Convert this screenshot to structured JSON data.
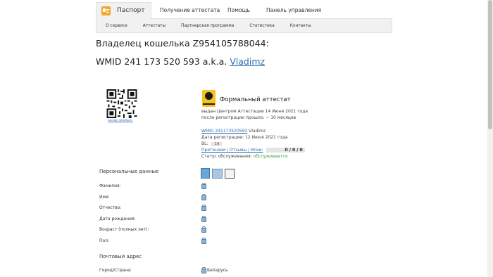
{
  "topnav": {
    "active": "Паспорт",
    "items": [
      "Получение аттестата",
      "Помощь",
      "Панель управления"
    ]
  },
  "subnav": [
    "О сервисе",
    "Аттестаты",
    "Партнерская программа",
    "Статистика",
    "Контакты"
  ],
  "owner": {
    "title": "Владелец кошелька Z954105788044:",
    "wmid_prefix": "WMID 241 173 520 593 a.k.a.",
    "nick": "Vladimz"
  },
  "qr": {
    "caption": "паспорт WebMoney"
  },
  "attestat": {
    "title": "Формальный аттестат",
    "issued": "выдан Центром Аттестации 14 Июня 2021 года",
    "after_reg": "после регистрации прошло: ~ 10 месяцев",
    "wmid_link": "WMID 241173520593",
    "wmid_nick": "Vladimz",
    "reg_date": "Дата регистрации: 12 Июня 2021 года",
    "bl_label": "BL:",
    "bl_value": "19",
    "claims_label": "Претензии / Отзывы / Иски:",
    "claims_value": "0 / 0 / 0",
    "status_label": "Статус обслуживания:",
    "status_value": "обслуживается"
  },
  "personal": {
    "heading": "Персональные данные",
    "rows": [
      "Фамилия:",
      "Имя:",
      "Отчество:",
      "Дата рождения:",
      "Возраст (полных лет):",
      "Пол:"
    ]
  },
  "address": {
    "heading": "Почтовый адрес",
    "country_label": "Город/Страна:",
    "country_value": "Беларусь"
  },
  "colors": {
    "link": "#2b6cb0",
    "ok": "#3aa53a",
    "bl": "#c0392b",
    "nav_bg": "#f1f1f1"
  }
}
